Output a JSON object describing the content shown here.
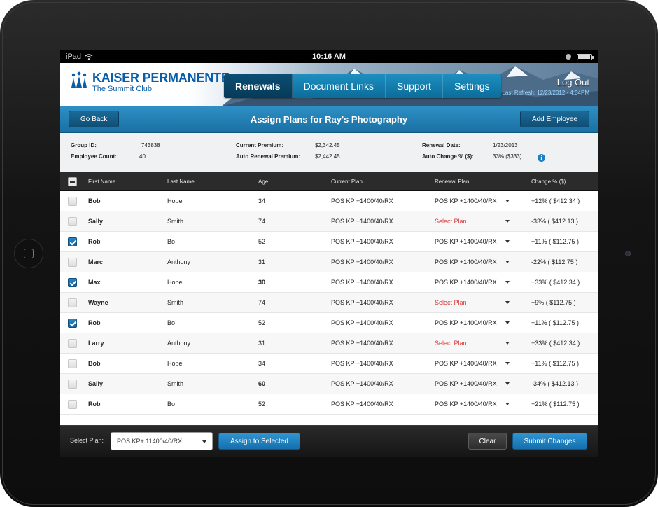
{
  "status_bar": {
    "device": "iPad",
    "time": "10:16 AM"
  },
  "header": {
    "logo_name": "KAISER PERMANENTE",
    "logo_sub": "The Summit Club",
    "tabs": [
      {
        "label": "Renewals",
        "active": true
      },
      {
        "label": "Document Links",
        "active": false
      },
      {
        "label": "Support",
        "active": false
      },
      {
        "label": "Settings",
        "active": false
      }
    ],
    "logout": "Log Out",
    "last_refresh": "Last Refresh: 12/23/2012 - 4:34PM"
  },
  "titlebar": {
    "back_label": "Go Back",
    "title": "Assign Plans for Ray's Photography",
    "add_label": "Add Employee"
  },
  "info": {
    "group_id_label": "Group ID:",
    "group_id": "743838",
    "employee_count_label": "Employee Count:",
    "employee_count": "40",
    "current_premium_label": "Current Premium:",
    "current_premium": "$2,342.45",
    "auto_renewal_premium_label": "Auto Renewal Premium:",
    "auto_renewal_premium": "$2,442.45",
    "renewal_date_label": "Renewal Date:",
    "renewal_date": "1/23/2013",
    "auto_change_label": "Auto Change % ($):",
    "auto_change": "33% ($333)"
  },
  "table": {
    "headers": [
      "First Name",
      "Last Name",
      "Age",
      "Current Plan",
      "Renewal Plan",
      "Change % ($)"
    ],
    "rows": [
      {
        "checked": false,
        "first": "Bob",
        "last": "Hope",
        "age": "34",
        "age_bold": false,
        "current": "POS KP +1400/40/RX",
        "renewal": "POS KP +1400/40/RX",
        "renewal_select": false,
        "change": "+12% ( $412.34 )"
      },
      {
        "checked": false,
        "first": "Sally",
        "last": "Smith",
        "age": "74",
        "age_bold": false,
        "current": "POS KP +1400/40/RX",
        "renewal": "Select Plan",
        "renewal_select": true,
        "change": "-33% ( $412.13 )"
      },
      {
        "checked": true,
        "first": "Rob",
        "last": "Bo",
        "age": "52",
        "age_bold": false,
        "current": "POS KP +1400/40/RX",
        "renewal": "POS KP +1400/40/RX",
        "renewal_select": false,
        "change": "+11% ( $112.75 )"
      },
      {
        "checked": false,
        "first": "Marc",
        "last": "Anthony",
        "age": "31",
        "age_bold": false,
        "current": "POS KP +1400/40/RX",
        "renewal": "POS KP +1400/40/RX",
        "renewal_select": false,
        "change": "-22% ( $112.75 )"
      },
      {
        "checked": true,
        "first": "Max",
        "last": "Hope",
        "age": "30",
        "age_bold": true,
        "current": "POS KP +1400/40/RX",
        "renewal": "POS KP +1400/40/RX",
        "renewal_select": false,
        "change": "+33% ( $412.34 )"
      },
      {
        "checked": false,
        "first": "Wayne",
        "last": "Smith",
        "age": "74",
        "age_bold": false,
        "current": "POS KP +1400/40/RX",
        "renewal": "Select Plan",
        "renewal_select": true,
        "change": "+9% ( $112.75 )"
      },
      {
        "checked": true,
        "first": "Rob",
        "last": "Bo",
        "age": "52",
        "age_bold": false,
        "current": "POS KP +1400/40/RX",
        "renewal": "POS KP +1400/40/RX",
        "renewal_select": false,
        "change": "+11% ( $112.75 )"
      },
      {
        "checked": false,
        "first": "Larry",
        "last": "Anthony",
        "age": "31",
        "age_bold": false,
        "current": "POS KP +1400/40/RX",
        "renewal": "Select Plan",
        "renewal_select": true,
        "change": "+33% ( $412.34 )"
      },
      {
        "checked": false,
        "first": "Bob",
        "last": "Hope",
        "age": "34",
        "age_bold": false,
        "current": "POS KP +1400/40/RX",
        "renewal": "POS KP +1400/40/RX",
        "renewal_select": false,
        "change": "+11% ( $112.75 )"
      },
      {
        "checked": false,
        "first": "Sally",
        "last": "Smith",
        "age": "60",
        "age_bold": true,
        "current": "POS KP +1400/40/RX",
        "renewal": "POS KP +1400/40/RX",
        "renewal_select": false,
        "change": "-34% ( $412.13 )"
      },
      {
        "checked": false,
        "first": "Rob",
        "last": "Bo",
        "age": "52",
        "age_bold": false,
        "current": "POS KP +1400/40/RX",
        "renewal": "POS KP +1400/40/RX",
        "renewal_select": false,
        "change": "+21% ( $112.75 )"
      }
    ]
  },
  "bottom_bar": {
    "select_label": "Select Plan:",
    "select_value": "POS KP+ 11400/40/RX",
    "assign_label": "Assign to Selected",
    "clear_label": "Clear",
    "submit_label": "Submit Changes"
  },
  "colors": {
    "brand_blue": "#0a5ea8",
    "accent_blue": "#1f7fb8",
    "select_plan_red": "#d63a3a"
  },
  "icons": [
    "wifi-icon",
    "battery-icon",
    "kaiser-logo-icon",
    "info-icon",
    "checkbox-icon",
    "dropdown-caret-icon"
  ]
}
